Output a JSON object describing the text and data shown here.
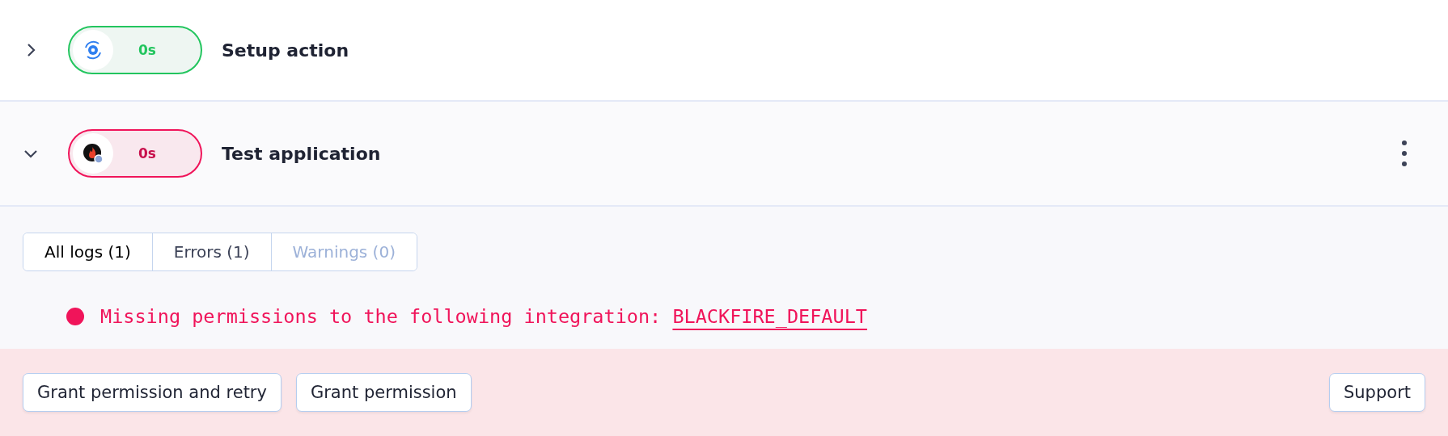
{
  "steps": [
    {
      "title": "Setup action",
      "duration": "0s",
      "kind": "success",
      "expanded": false,
      "menu": false
    },
    {
      "title": "Test application",
      "duration": "0s",
      "kind": "failure",
      "expanded": true,
      "menu": true
    }
  ],
  "log_tabs": [
    {
      "label": "All logs (1)",
      "selected": true,
      "disabled": false
    },
    {
      "label": "Errors (1)",
      "selected": false,
      "disabled": false
    },
    {
      "label": "Warnings (0)",
      "selected": false,
      "disabled": true
    }
  ],
  "logs": [
    {
      "color": "#f0145a",
      "message": "Missing permissions to the following integration: ",
      "link": "BLACKFIRE_DEFAULT"
    }
  ],
  "actions": [
    "Grant permission and retry",
    "Grant permission"
  ],
  "support": "Support"
}
